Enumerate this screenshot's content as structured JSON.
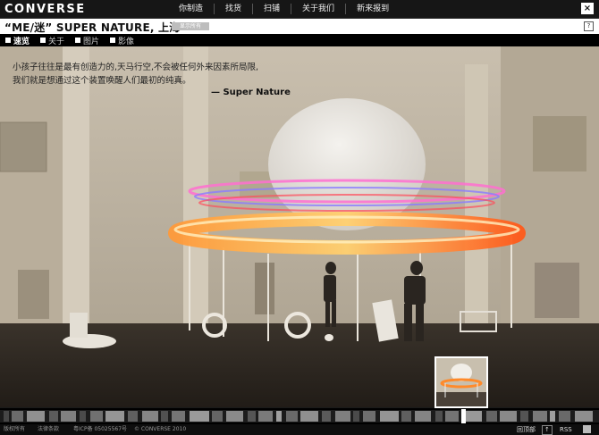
{
  "header": {
    "logo": "CONVERSE",
    "nav": [
      "你制造",
      "找货",
      "扫铺",
      "关于我们",
      "新来报到"
    ],
    "close_label": "×"
  },
  "title_bar": {
    "title": "“ME/迷”   SUPER NATURE, 上海",
    "tag": "显示所有",
    "help_label": "?"
  },
  "tabs": [
    {
      "label": "速览",
      "active": true
    },
    {
      "label": "关于",
      "active": false
    },
    {
      "label": "图片",
      "active": false
    },
    {
      "label": "影像",
      "active": false
    }
  ],
  "quote": {
    "line1": "小孩子往往是最有创造力的,天马行空,不会被任何外来因素所局限,",
    "line2": "我们就是想通过这个装置唤醒人们最初的纯真。",
    "author": "— Super Nature"
  },
  "footer": {
    "copyright": "版权所有",
    "legal": "法律条款",
    "icp": "粤ICP备 05025567号",
    "converse": "© CONVERSE 2010",
    "back_label": "回顶部",
    "back_icon_label": "↑",
    "rss_label": "RSS"
  },
  "colors": {
    "topbar": "#161616",
    "tabbar": "#000000",
    "ring_glow": "#ff6a1a"
  }
}
